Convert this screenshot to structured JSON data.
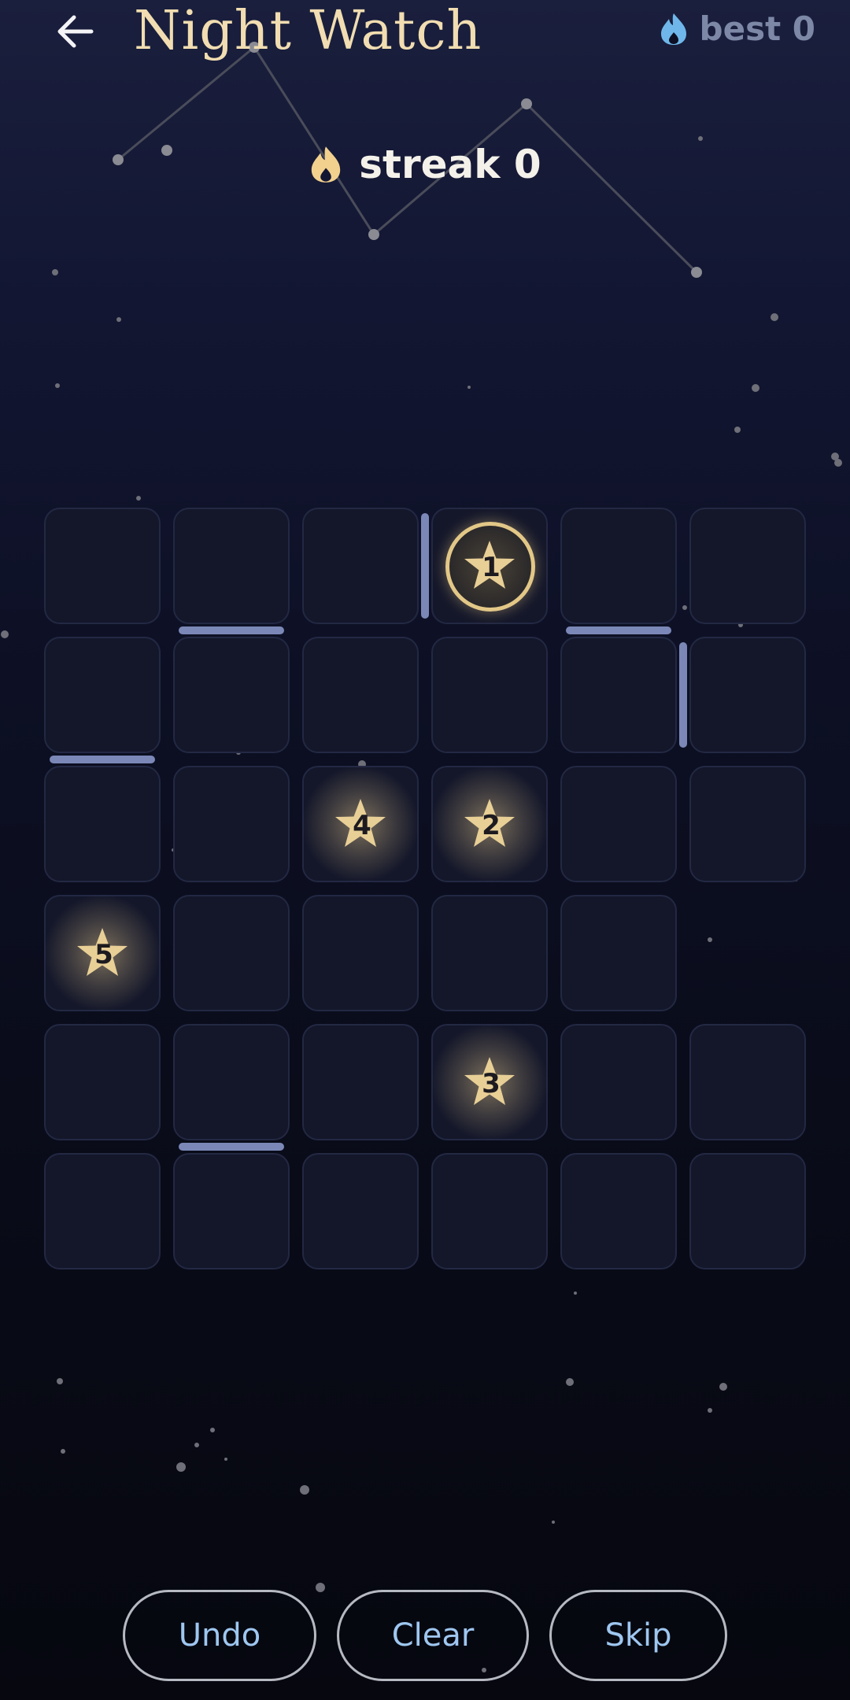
{
  "header": {
    "title": "Night Watch",
    "back_icon": "arrow-left-icon",
    "best_label": "best 0",
    "best_icon": "flame-icon",
    "best_color": "#6fb7ea"
  },
  "status": {
    "streak_label": "streak 0",
    "streak_icon": "flame-icon",
    "streak_color": "#f2d18f"
  },
  "board": {
    "rows": 6,
    "cols": 6,
    "empty_cells": [
      [
        3,
        5
      ]
    ],
    "stars": [
      {
        "num": "1",
        "row": 0,
        "col": 3,
        "selected": true
      },
      {
        "num": "2",
        "row": 2,
        "col": 3,
        "selected": false
      },
      {
        "num": "3",
        "row": 4,
        "col": 3,
        "selected": false
      },
      {
        "num": "4",
        "row": 2,
        "col": 2,
        "selected": false
      },
      {
        "num": "5",
        "row": 3,
        "col": 0,
        "selected": false
      }
    ],
    "walls_h": [
      [
        0,
        1
      ],
      [
        0,
        4
      ],
      [
        1,
        0
      ],
      [
        4,
        1
      ]
    ],
    "walls_v": [
      [
        0,
        2
      ],
      [
        1,
        4
      ]
    ],
    "colors": {
      "star": "#e8cf96",
      "wall": "#7b88b7",
      "ring": "#e2c787"
    }
  },
  "controls": {
    "undo": "Undo",
    "clear": "Clear",
    "skip": "Skip"
  }
}
